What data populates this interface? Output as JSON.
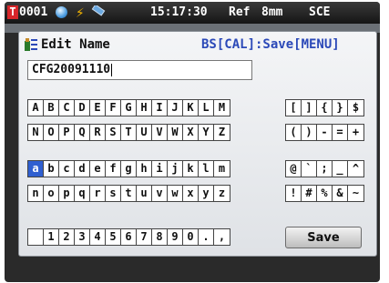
{
  "status_bar": {
    "badge": "T",
    "device_id": "0001",
    "time": "15:17:30",
    "ref": "Ref",
    "mm": "8mm",
    "sce": "SCE"
  },
  "dialog": {
    "title": "Edit Name",
    "hint": "BS[CAL]:Save[MENU]",
    "name_value": "CFG20091110",
    "save_label": "Save"
  },
  "keyboard": {
    "upper1": [
      "A",
      "B",
      "C",
      "D",
      "E",
      "F",
      "G",
      "H",
      "I",
      "J",
      "K",
      "L",
      "M"
    ],
    "upper2": [
      "N",
      "O",
      "P",
      "Q",
      "R",
      "S",
      "T",
      "U",
      "V",
      "W",
      "X",
      "Y",
      "Z"
    ],
    "lower1": [
      "a",
      "b",
      "c",
      "d",
      "e",
      "f",
      "g",
      "h",
      "i",
      "j",
      "k",
      "l",
      "m"
    ],
    "lower2": [
      "n",
      "o",
      "p",
      "q",
      "r",
      "s",
      "t",
      "u",
      "v",
      "w",
      "x",
      "y",
      "z"
    ],
    "digits": [
      "",
      "1",
      "2",
      "3",
      "4",
      "5",
      "6",
      "7",
      "8",
      "9",
      "0",
      ".",
      ","
    ],
    "sym1": [
      "[",
      "]",
      "{",
      "}",
      "$"
    ],
    "sym2": [
      "(",
      ")",
      "-",
      "=",
      "+"
    ],
    "sym3": [
      "@",
      "`",
      ";",
      "_",
      "^"
    ],
    "sym4": [
      "!",
      "#",
      "%",
      "&",
      "~"
    ],
    "selected": "a"
  },
  "colors": {
    "selected_key": "#2f5fd0",
    "hint_text": "#2b49b8",
    "badge_red": "#d8262a",
    "bolt": "#f2b300"
  },
  "icons": [
    "sphere-icon",
    "bolt-icon",
    "probe-icon",
    "edit-name-icon"
  ]
}
